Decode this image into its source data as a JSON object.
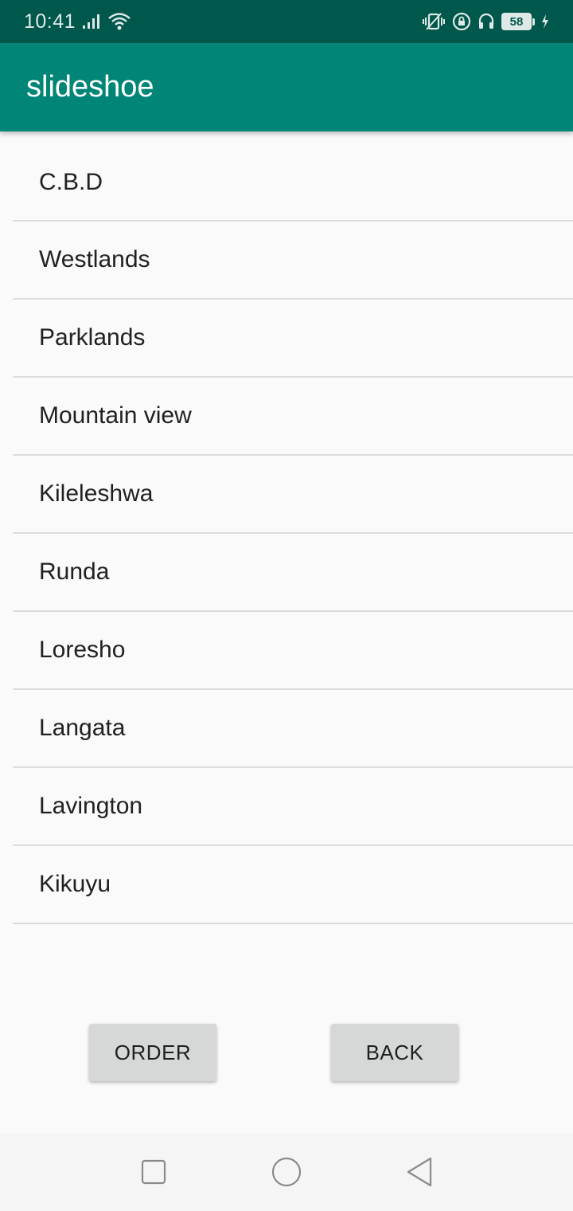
{
  "status_bar": {
    "time": "10:41",
    "battery_level": "58",
    "icons": [
      "signal-icon",
      "wifi-icon",
      "vibrate-icon",
      "rotation-lock-icon",
      "headset-icon",
      "battery-icon",
      "charging-icon"
    ]
  },
  "app_bar": {
    "title": "slideshoe",
    "color": "#008577"
  },
  "locations": [
    "C.B.D",
    "Westlands",
    "Parklands",
    "Mountain view",
    "Kileleshwa",
    "Runda",
    "Loresho",
    "Langata",
    "Lavington",
    "Kikuyu"
  ],
  "buttons": {
    "order_label": "ORDER",
    "back_label": "BACK"
  },
  "nav_bar": {
    "icons": [
      "recents-square-icon",
      "home-circle-icon",
      "back-triangle-icon"
    ]
  }
}
